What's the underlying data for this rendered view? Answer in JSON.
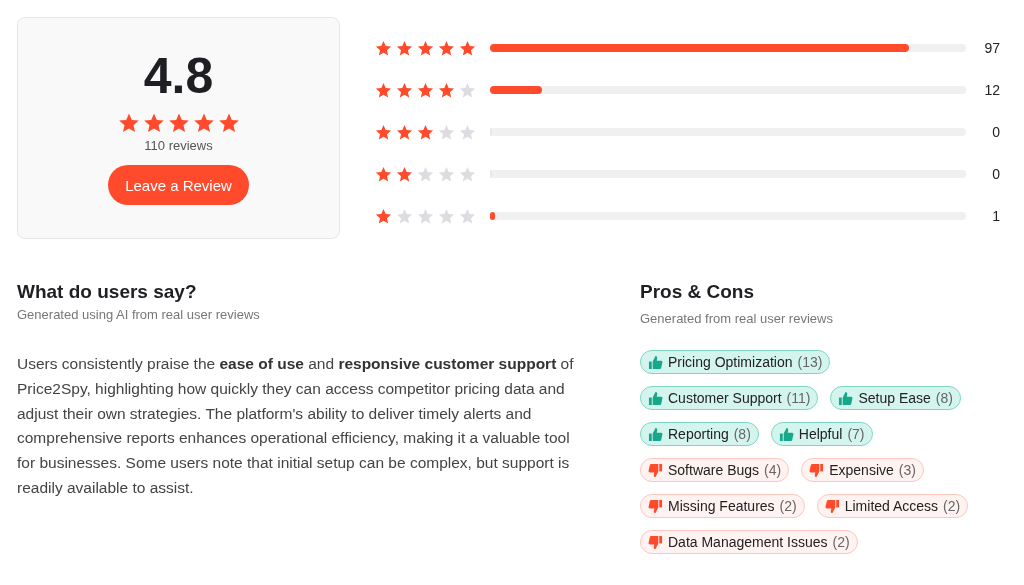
{
  "summary": {
    "rating": "4.8",
    "stars": 5,
    "count": "110 reviews",
    "button": "Leave a Review"
  },
  "breakdown": [
    {
      "stars": 5,
      "level": 0.88,
      "count": "97"
    },
    {
      "stars": 4,
      "level": 0.11,
      "count": "12"
    },
    {
      "stars": 3,
      "level": 0,
      "count": "0"
    },
    {
      "stars": 2,
      "level": 0,
      "count": "0"
    },
    {
      "stars": 1,
      "level": 0.01,
      "count": "1"
    }
  ],
  "users_say": {
    "title": "What do users say?",
    "subtitle": "Generated using AI from real user reviews",
    "text": "Users consistently praise the **ease of use** and **responsive customer support** of Price2Spy, highlighting how quickly they can access competitor pricing data and adjust their own strategies. The platform's ability to deliver timely alerts and comprehensive reports enhances operational efficiency, making it a valuable tool for businesses. Some users note that initial setup can be complex, but support is readily available to assist."
  },
  "pros_cons": {
    "title": "Pros & Cons",
    "subtitle": "Generated from real user reviews",
    "rows": [
      [
        {
          "kind": "pro",
          "label": "Pricing Optimization",
          "count": "(13)"
        }
      ],
      [
        {
          "kind": "pro",
          "label": "Customer Support",
          "count": "(11)"
        },
        {
          "kind": "pro",
          "label": "Setup Ease",
          "count": "(8)"
        }
      ],
      [
        {
          "kind": "pro",
          "label": "Reporting",
          "count": "(8)"
        },
        {
          "kind": "pro",
          "label": "Helpful",
          "count": "(7)"
        }
      ],
      [
        {
          "kind": "con",
          "label": "Software Bugs",
          "count": "(4)"
        },
        {
          "kind": "con",
          "label": "Expensive",
          "count": "(3)"
        }
      ],
      [
        {
          "kind": "con",
          "label": "Missing Features",
          "count": "(2)"
        },
        {
          "kind": "con",
          "label": "Limited Access",
          "count": "(2)"
        }
      ],
      [
        {
          "kind": "con",
          "label": "Data Management Issues",
          "count": "(2)"
        }
      ]
    ]
  }
}
